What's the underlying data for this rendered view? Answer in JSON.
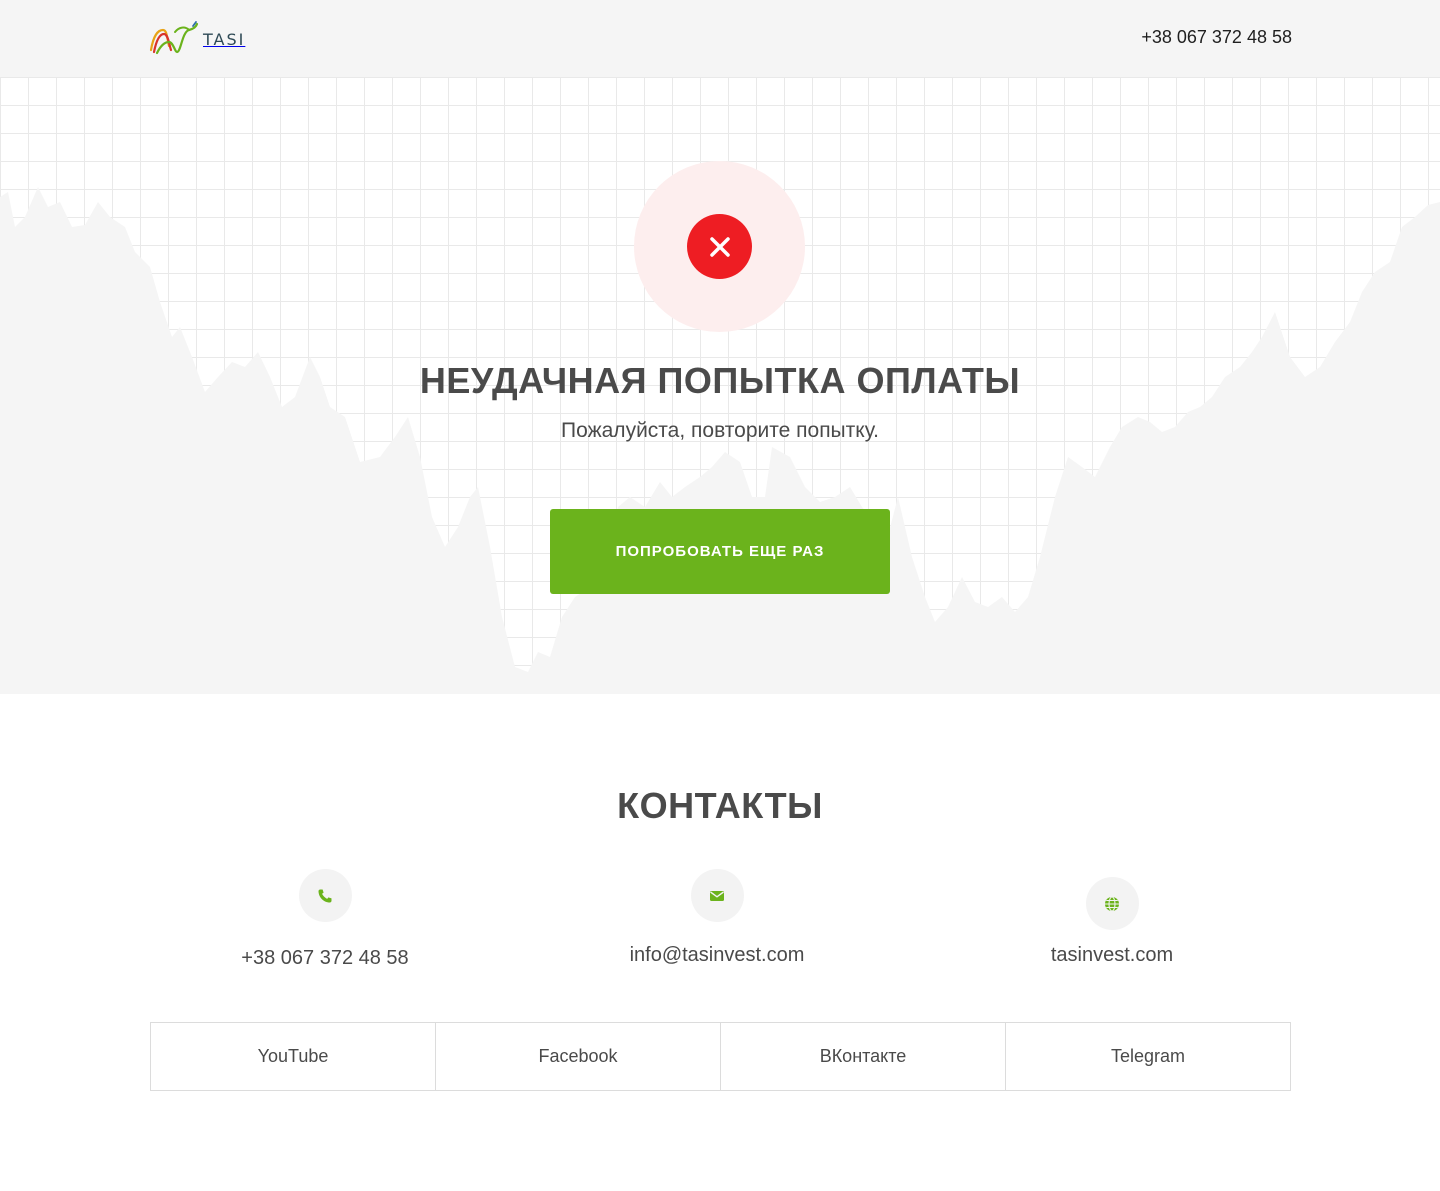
{
  "header": {
    "logo_text": "TASI",
    "phone": "+38 067 372 48 58"
  },
  "hero": {
    "title": "НЕУДАЧНАЯ ПОПЫТКА ОПЛАТЫ",
    "subtitle": "Пожалуйста, повторите попытку.",
    "retry_label": "ПОПРОБОВАТЬ ЕЩЕ РАЗ",
    "error_icon": "close-icon"
  },
  "contacts": {
    "title": "КОНТАКТЫ",
    "items": [
      {
        "icon": "phone-icon",
        "value": "+38 067 372 48 58"
      },
      {
        "icon": "mail-icon",
        "value": "info@tasinvest.com"
      },
      {
        "icon": "globe-icon",
        "value": "tasinvest.com"
      }
    ]
  },
  "social": {
    "links": [
      {
        "label": "YouTube"
      },
      {
        "label": "Facebook"
      },
      {
        "label": "ВКонтакте"
      },
      {
        "label": "Telegram"
      }
    ]
  },
  "colors": {
    "accent_green": "#6bb31c",
    "error_red": "#ee1d23",
    "error_bg": "#fdeeee",
    "header_bg": "#f5f5f5",
    "text": "#4a4a4a"
  }
}
